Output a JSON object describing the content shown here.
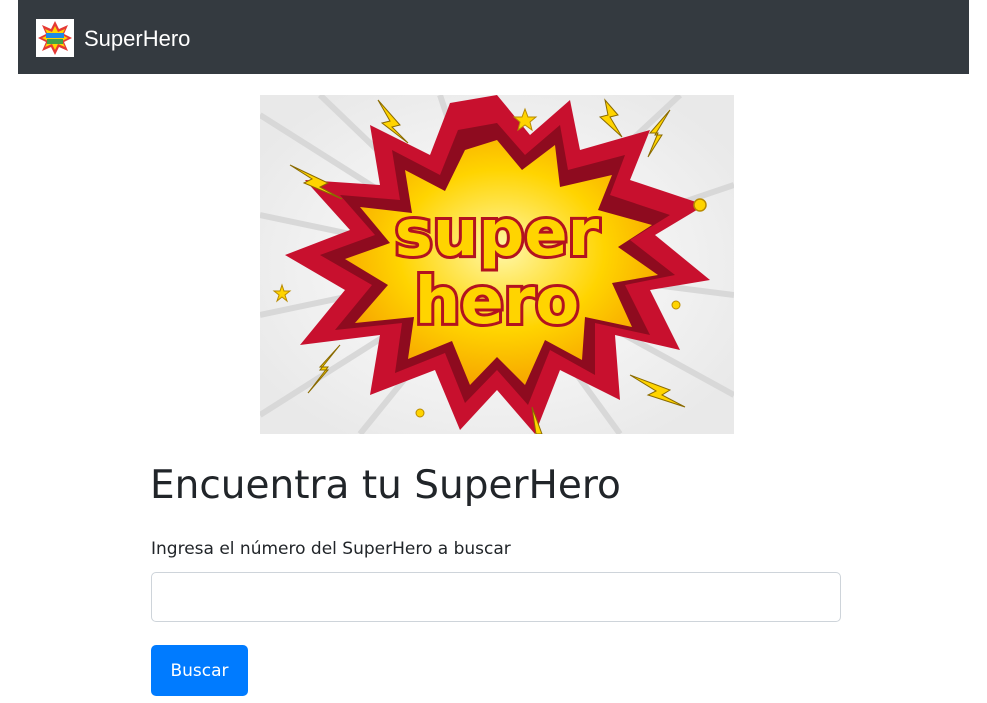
{
  "navbar": {
    "brand": "SuperHero",
    "logo_icon": "comic-logo-icon"
  },
  "banner": {
    "line1": "super",
    "line2": "hero",
    "colors": {
      "burst_outer": "#c8102e",
      "burst_inner": "#ffd400",
      "text_fill": "#ffd400",
      "text_outline": "#b3121f"
    }
  },
  "main": {
    "title": "Encuentra tu SuperHero",
    "label": "Ingresa el número del SuperHero a buscar",
    "input_value": "",
    "button_label": "Buscar"
  },
  "colors": {
    "navbar_bg": "#343a40",
    "primary": "#007bff",
    "text": "#212529"
  }
}
